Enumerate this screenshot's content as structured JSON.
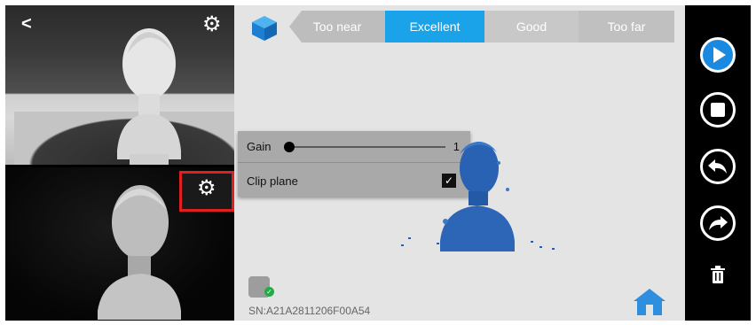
{
  "left_panel": {
    "back_icon": "chevron-left-icon",
    "top_gear_icon": "gear-icon",
    "bottom_gear_icon": "gear-icon",
    "highlight_color": "#e0201f"
  },
  "distance_indicator": {
    "segments": [
      "Too near",
      "Excellent",
      "Good",
      "Too far"
    ],
    "active": "Excellent",
    "active_color": "#1aa3e8"
  },
  "settings": {
    "gain_label": "Gain",
    "gain_value": "1",
    "clip_plane_label": "Clip plane",
    "clip_plane_checked": true
  },
  "status": {
    "sn": "SN:A21A2811206F00A54",
    "device_connected": true
  },
  "controls": {
    "play_color": "#1a8ae0",
    "items": [
      "play-icon",
      "stop-icon",
      "undo-icon",
      "redo-icon",
      "trash-icon"
    ]
  }
}
